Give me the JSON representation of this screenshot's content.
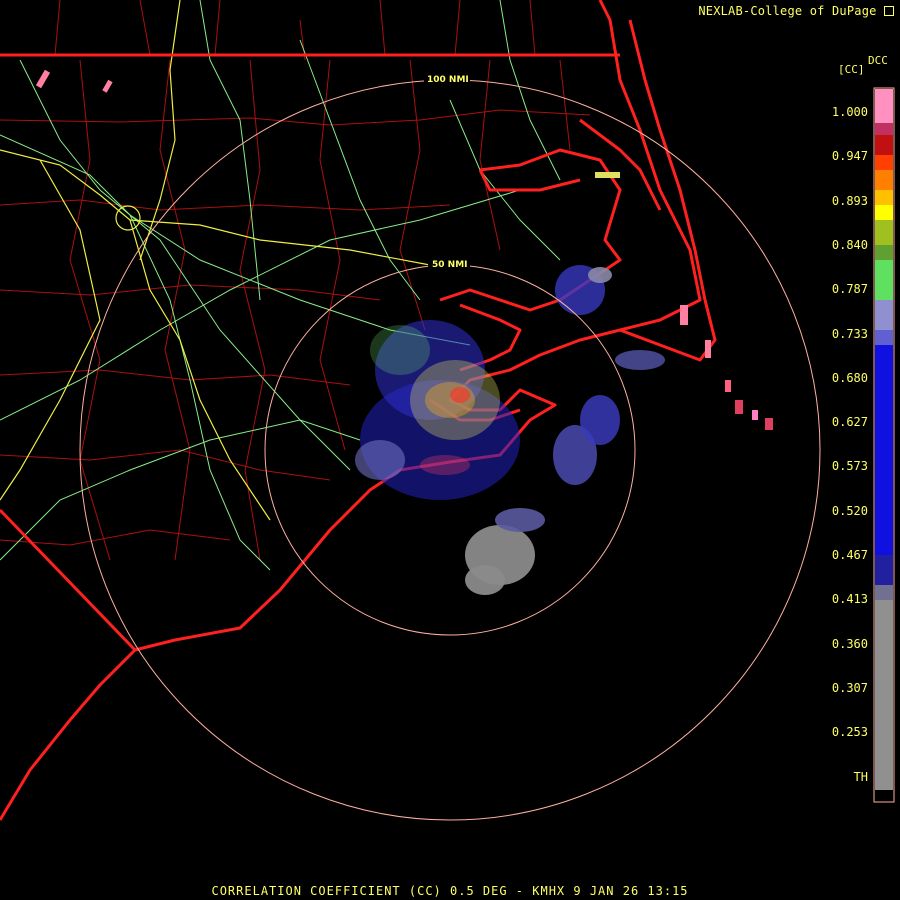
{
  "credit": "NEXLAB-College of DuPage",
  "footer": "CORRELATION COEFFICIENT (CC) 0.5 DEG - KMHX 9 JAN 26 13:15",
  "range_rings": [
    {
      "label": "50 NMI"
    },
    {
      "label": "100 NMI"
    }
  ],
  "legend": {
    "product_code": "DCC",
    "units": "[CC]",
    "labels": [
      "1.000",
      "0.947",
      "0.893",
      "0.840",
      "0.787",
      "0.733",
      "0.680",
      "0.627",
      "0.573",
      "0.520",
      "0.467",
      "0.413",
      "0.360",
      "0.307",
      "0.253",
      "TH"
    ]
  },
  "colors": {
    "background": "#000000",
    "annotation": "#ffff66",
    "state_borders": "#ff2020",
    "county_borders": "#aa1010",
    "highways": "#88ee88",
    "interstates": "#eeee44",
    "range_rings": "#ffb0a0"
  }
}
